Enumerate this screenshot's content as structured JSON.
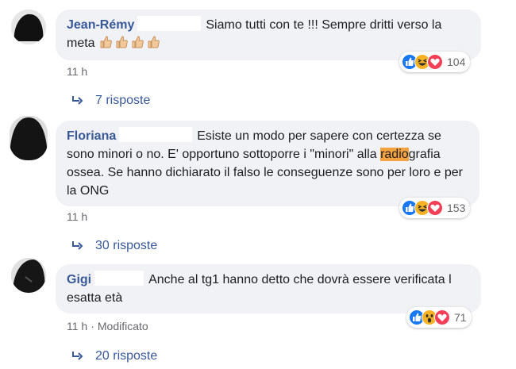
{
  "comments": [
    {
      "author": "Jean-Rémy",
      "text_before": "Siamo tutti con te !!! Sempre dritti verso la meta",
      "text_highlight": "",
      "text_after": "",
      "reaction_icons": [
        "like-icon",
        "haha-icon",
        "love-icon"
      ],
      "reaction_count": "104",
      "time": "11 h",
      "edited": "",
      "replies": "7 risposte"
    },
    {
      "author": "Floriana",
      "text_before": "Esiste un modo per sapere con certezza se sono minori o no. E' opportuno sottoporre i \"minori\" alla ",
      "text_highlight": "radio",
      "text_after": "grafia ossea. Se hanno dichiarato il falso le conseguenze sono per loro e per la ONG",
      "reaction_icons": [
        "like-icon",
        "haha-icon",
        "love-icon"
      ],
      "reaction_count": "153",
      "time": "11 h",
      "edited": "",
      "replies": "30 risposte"
    },
    {
      "author": "Gigi",
      "text_before": "Anche al tg1 hanno detto che dovrà essere verificata l esatta età",
      "text_highlight": "",
      "text_after": "",
      "reaction_icons": [
        "like-icon",
        "wow-icon",
        "love-icon"
      ],
      "reaction_count": "71",
      "time": "11 h",
      "edited": "Modificato",
      "replies": "20 risposte"
    }
  ],
  "separator": "·",
  "colors": {
    "author": "#385898",
    "bubble": "#f0f2f5",
    "highlight": "#f5a341",
    "like": "#1877f2",
    "love": "#f33e58",
    "haha": "#f7b125"
  }
}
